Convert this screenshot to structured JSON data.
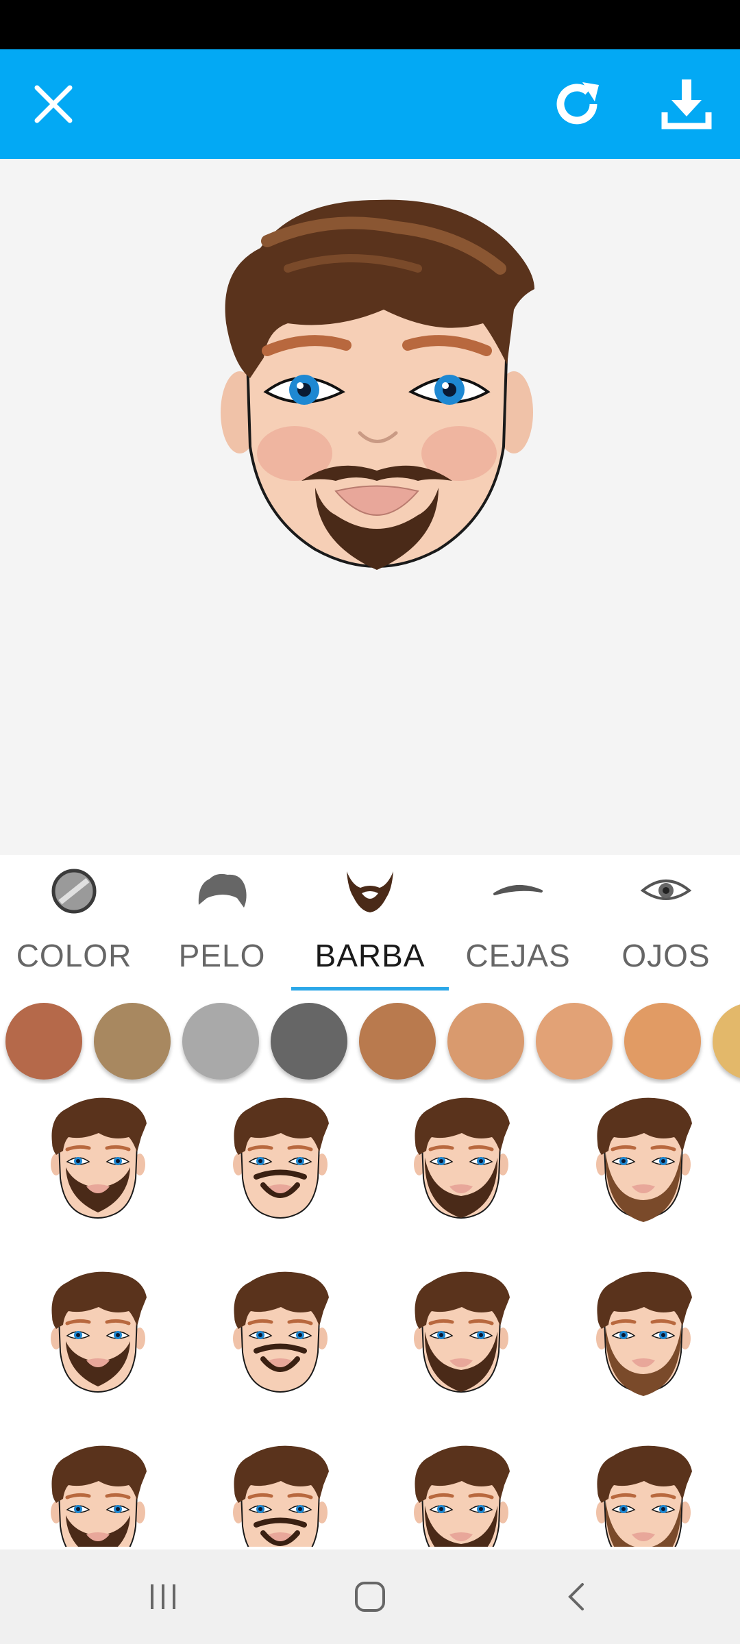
{
  "colors": {
    "app_bar": "#03a9f4",
    "tab_indicator": "#2aa7e8",
    "canvas_bg": "#f4f4f4"
  },
  "toolbar": {
    "close_icon": "close-icon",
    "refresh_icon": "refresh-icon",
    "download_icon": "download-icon"
  },
  "tabs": [
    {
      "label": "COLOR",
      "icon": "color-disc-icon",
      "active": false
    },
    {
      "label": "PELO",
      "icon": "hair-icon",
      "active": false
    },
    {
      "label": "BARBA",
      "icon": "beard-icon",
      "active": true
    },
    {
      "label": "CEJAS",
      "icon": "eyebrow-icon",
      "active": false
    },
    {
      "label": "OJOS",
      "icon": "eye-icon",
      "active": false
    }
  ],
  "swatches": [
    "#b5694a",
    "#a88860",
    "#a9a9a9",
    "#666666",
    "#b97a4e",
    "#d99a6e",
    "#e2a276",
    "#e19b64",
    "#e3b86a"
  ],
  "beard_styles": [
    "goatee-stubble",
    "mustache-chin",
    "full-short",
    "full-medium",
    "short-boxed",
    "full-scruffy",
    "goatee-wide",
    "long-full",
    "style-9",
    "style-10",
    "style-11",
    "style-12"
  ],
  "nav": {
    "recents_icon": "recents-icon",
    "home_icon": "home-icon",
    "back_icon": "back-icon"
  }
}
